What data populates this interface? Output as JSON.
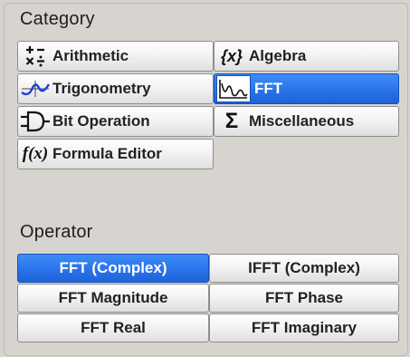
{
  "category": {
    "title": "Category",
    "items": [
      {
        "label": "Arithmetic",
        "icon": "arithmetic-icon",
        "active": false
      },
      {
        "label": "Algebra",
        "icon": "algebra-icon",
        "active": false
      },
      {
        "label": "Trigonometry",
        "icon": "trigonometry-icon",
        "active": false
      },
      {
        "label": "FFT",
        "icon": "fft-icon",
        "active": true
      },
      {
        "label": "Bit Operation",
        "icon": "bit-operation-icon",
        "active": false
      },
      {
        "label": "Miscellaneous",
        "icon": "sigma-icon",
        "active": false
      },
      {
        "label": "Formula Editor",
        "icon": "formula-editor-icon",
        "active": false
      }
    ],
    "algebra_icon_text": "{x}",
    "formula_icon_text": "f(x)",
    "sigma_icon_text": "Σ"
  },
  "operator": {
    "title": "Operator",
    "items": [
      {
        "label": "FFT (Complex)",
        "active": true
      },
      {
        "label": "IFFT (Complex)",
        "active": false
      },
      {
        "label": "FFT Magnitude",
        "active": false
      },
      {
        "label": "FFT Phase",
        "active": false
      },
      {
        "label": "FFT Real",
        "active": false
      },
      {
        "label": "FFT Imaginary",
        "active": false
      }
    ]
  },
  "colors": {
    "active": "#2a73ea",
    "background": "#d6d3cf"
  }
}
